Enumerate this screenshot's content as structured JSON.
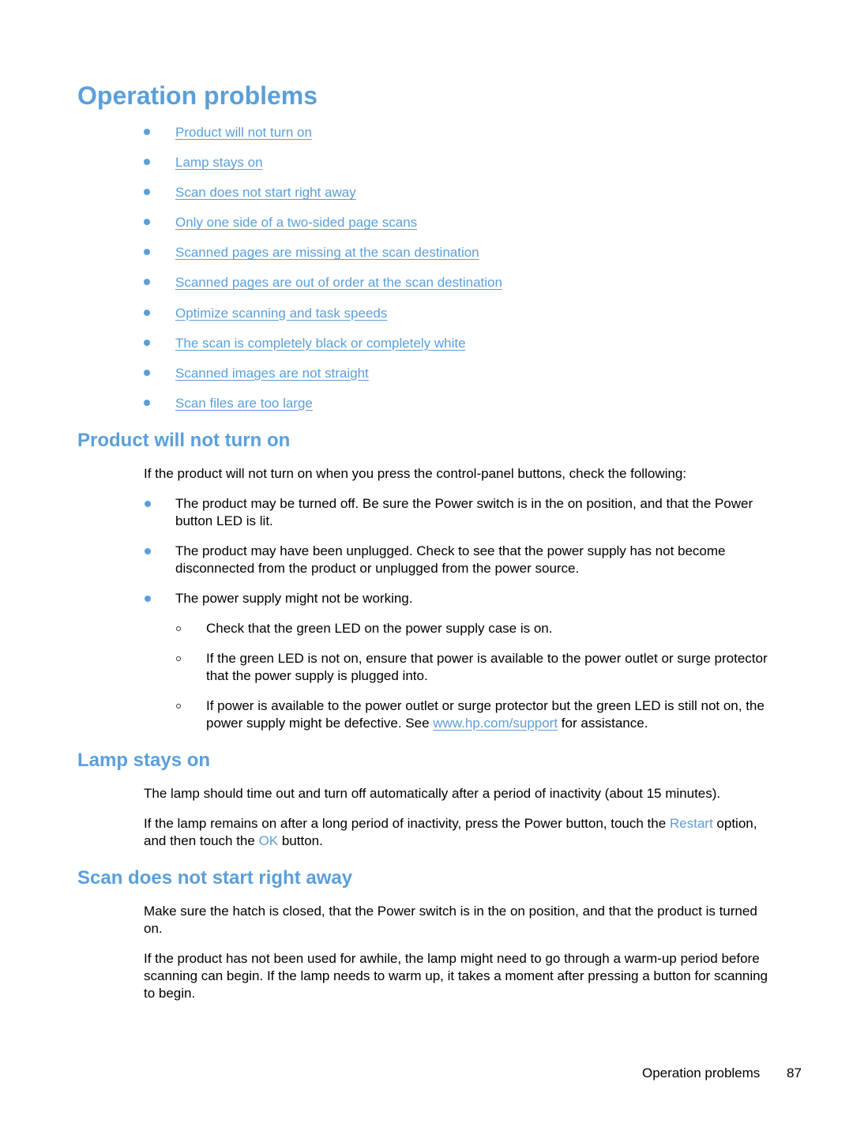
{
  "page_title": "Operation problems",
  "toc": [
    "Product will not turn on",
    "Lamp stays on",
    "Scan does not start right away",
    "Only one side of a two-sided page scans",
    "Scanned pages are missing at the scan destination",
    "Scanned pages are out of order at the scan destination",
    "Optimize scanning and task speeds",
    "The scan is completely black or completely white",
    "Scanned images are not straight",
    "Scan files are too large"
  ],
  "sections": {
    "product_not_on": {
      "heading": "Product will not turn on",
      "intro": "If the product will not turn on when you press the control-panel buttons, check the following:",
      "bullets": [
        "The product may be turned off. Be sure the Power switch is in the on position, and that the Power button LED is lit.",
        "The product may have been unplugged. Check to see that the power supply has not become disconnected from the product or unplugged from the power source.",
        "The power supply might not be working."
      ],
      "subbullets": [
        "Check that the green LED on the power supply case is on.",
        "If the green LED is not on, ensure that power is available to the power outlet or surge protector that the power supply is plugged into."
      ],
      "last_sub": {
        "before": "If power is available to the power outlet or surge protector but the green LED is still not on, the power supply might be defective. See ",
        "link": "www.hp.com/support",
        "after": " for assistance."
      }
    },
    "lamp": {
      "heading": "Lamp stays on",
      "para1": "The lamp should time out and turn off automatically after a period of inactivity (about 15 minutes).",
      "para2": {
        "a": "If the lamp remains on after a long period of inactivity, press the Power button, touch the ",
        "restart": "Restart",
        "b": " option, and then touch the ",
        "ok": "OK",
        "c": " button."
      }
    },
    "scan_start": {
      "heading": "Scan does not start right away",
      "para1": "Make sure the hatch is closed, that the Power switch is in the on position, and that the product is turned on.",
      "para2": "If the product has not been used for awhile, the lamp might need to go through a warm-up period before scanning can begin. If the lamp needs to warm up, it takes a moment after pressing a button for scanning to begin."
    }
  },
  "footer": {
    "section": "Operation problems",
    "page": "87"
  },
  "colors": {
    "accent": "#5b9fd9",
    "text": "#000000"
  }
}
